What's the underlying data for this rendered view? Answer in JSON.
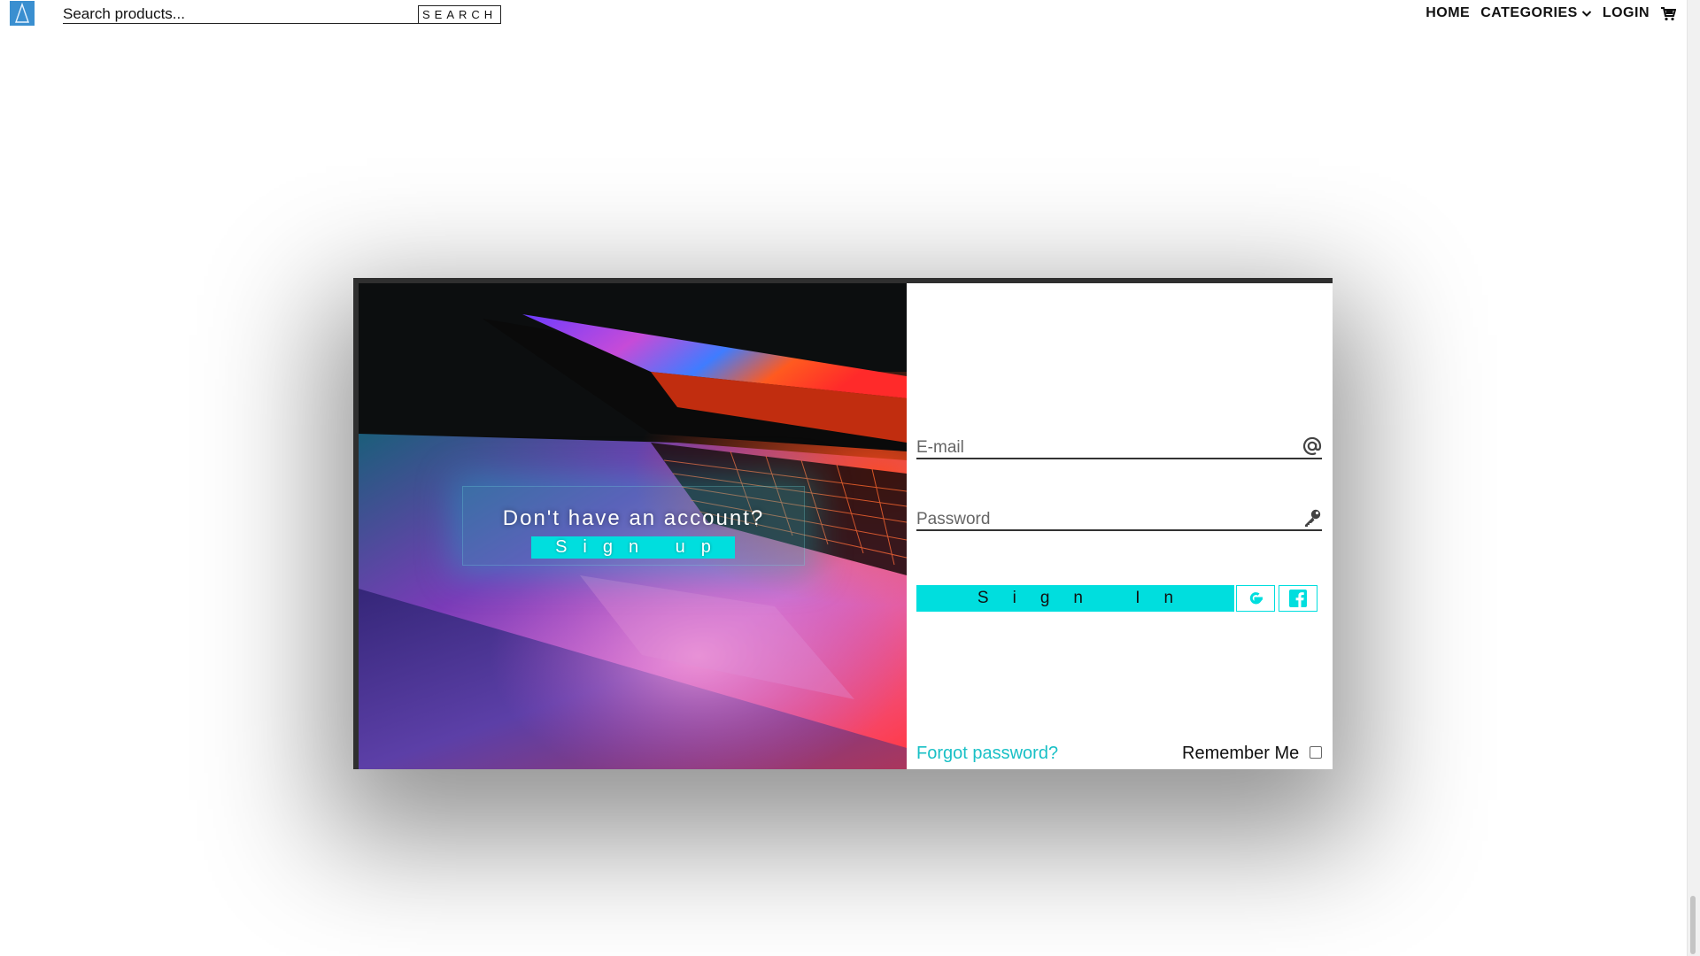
{
  "search": {
    "placeholder": "Search products...",
    "button_label": "SEARCH"
  },
  "nav": {
    "home_label": "HOME",
    "categories_label": "CATEGORIES",
    "login_label": "LOGIN"
  },
  "signup_panel": {
    "prompt": "Don't have an account?",
    "button_label": "Sign up"
  },
  "login_form": {
    "email_placeholder": "E-mail",
    "password_placeholder": "Password",
    "signin_label": "Sign In",
    "forgot_password_label": "Forgot password?",
    "remember_me_label": "Remember Me",
    "remember_me_checked": false
  },
  "icons": {
    "logo": "triangle-logo-icon",
    "categories_dropdown": "chevron-down-icon",
    "cart": "shopping-cart-icon",
    "email_field": "at-sign-icon",
    "password_field": "key-icon",
    "google": "google-icon",
    "facebook": "facebook-icon"
  },
  "colors": {
    "accent": "#00dede",
    "link": "#19c0c6",
    "logo": "#3a8fd0",
    "text": "#111111"
  }
}
